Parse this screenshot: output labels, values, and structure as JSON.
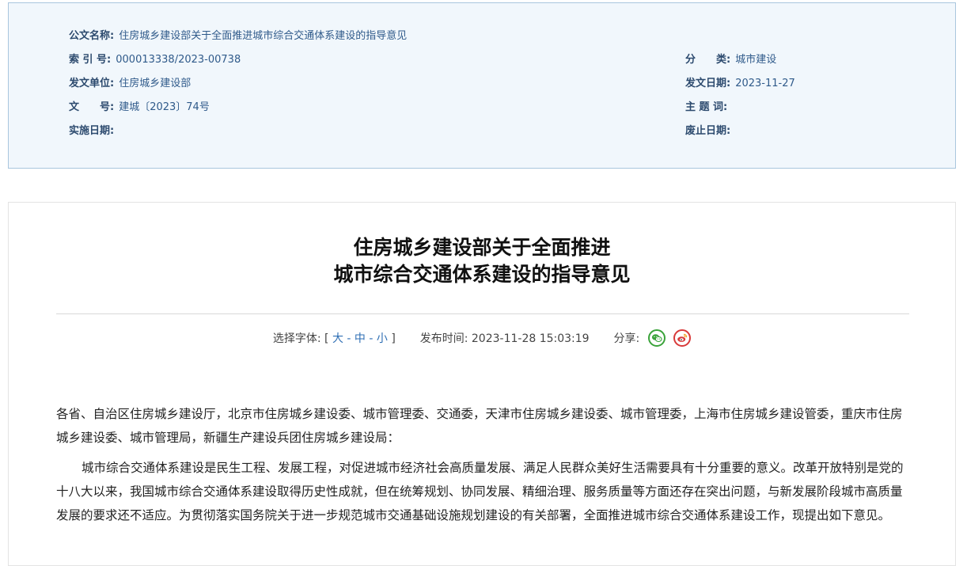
{
  "meta": {
    "name_label": "公文名称:",
    "name_value": "住房城乡建设部关于全面推进城市综合交通体系建设的指导意见",
    "index_label": "索 引 号:",
    "index_value": "000013338/2023-00738",
    "category_label": "分　　类:",
    "category_value": "城市建设",
    "issuer_label": "发文单位:",
    "issuer_value": "住房城乡建设部",
    "issue_date_label": "发文日期:",
    "issue_date_value": "2023-11-27",
    "doc_no_label": "文　　号:",
    "doc_no_value": "建城〔2023〕74号",
    "subject_label": "主 题 词:",
    "subject_value": "",
    "effective_label": "实施日期:",
    "effective_value": "",
    "expiry_label": "废止日期:",
    "expiry_value": ""
  },
  "article": {
    "title_line1": "住房城乡建设部关于全面推进",
    "title_line2": "城市综合交通体系建设的指导意见",
    "font_select_label": "选择字体:",
    "bracket_open": "[",
    "font_large": "大",
    "font_medium": "中",
    "font_small": "小",
    "sep": "-",
    "bracket_close": "]",
    "publish_label": "发布时间:",
    "publish_time": "2023-11-28 15:03:19",
    "share_label": "分享:",
    "share_icons": [
      "wechat-icon",
      "weibo-icon"
    ],
    "salutation": "各省、自治区住房城乡建设厅，北京市住房城乡建设委、城市管理委、交通委，天津市住房城乡建设委、城市管理委，上海市住房城乡建设管委，重庆市住房城乡建设委、城市管理局，新疆生产建设兵团住房城乡建设局：",
    "paragraph1": "城市综合交通体系建设是民生工程、发展工程，对促进城市经济社会高质量发展、满足人民群众美好生活需要具有十分重要的意义。改革开放特别是党的十八大以来，我国城市综合交通体系建设取得历史性成就，但在统筹规划、协同发展、精细治理、服务质量等方面还存在突出问题，与新发展阶段城市高质量发展的要求还不适应。为贯彻落实国务院关于进一步规范城市交通基础设施规划建设的有关部署，全面推进城市综合交通体系建设工作，现提出如下意见。"
  },
  "colors": {
    "meta_bg": "#f1f7fc",
    "meta_border": "#a9c6de",
    "link": "#2f6fb4",
    "wechat": "#3aa33a",
    "weibo": "#d83a3a"
  }
}
